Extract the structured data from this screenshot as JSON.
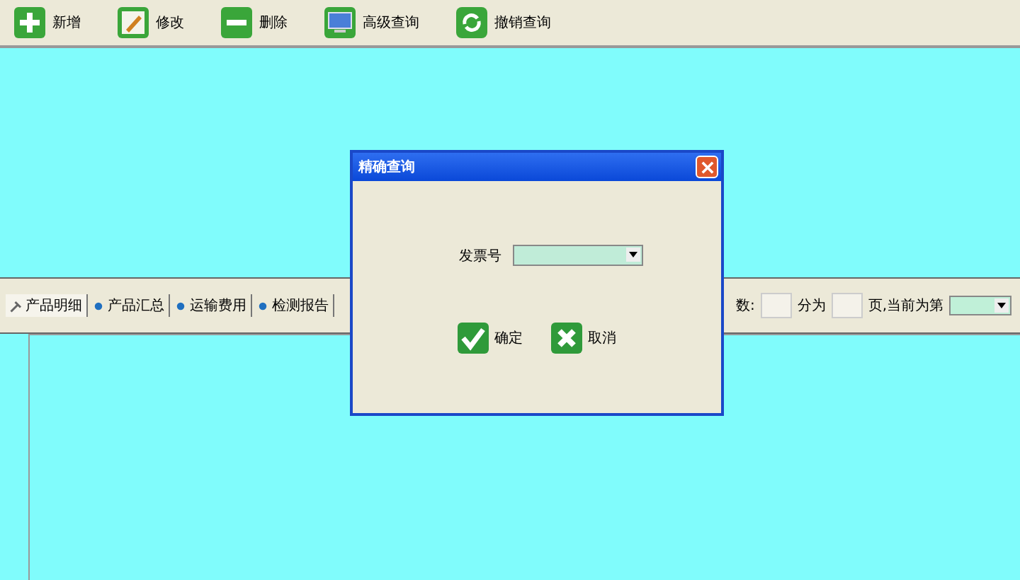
{
  "toolbar": [
    {
      "label": "新增",
      "kind": "add"
    },
    {
      "label": "修改",
      "kind": "edit"
    },
    {
      "label": "删除",
      "kind": "delete"
    },
    {
      "label": "高级查询",
      "kind": "monitor"
    },
    {
      "label": "撤销查询",
      "kind": "refresh"
    }
  ],
  "tabs": [
    {
      "label": "产品明细",
      "selected": true
    },
    {
      "label": "产品汇总",
      "selected": false
    },
    {
      "label": "运输费用",
      "selected": false
    },
    {
      "label": "检测报告",
      "selected": false
    }
  ],
  "pager": {
    "count_label": "数:",
    "split_label": "分为",
    "page_label": "页,当前为第"
  },
  "dialog": {
    "title": "精确查询",
    "field_label": "发票号",
    "buttons": [
      {
        "label": "确定",
        "kind": "ok"
      },
      {
        "label": "取消",
        "kind": "cancel"
      }
    ]
  }
}
